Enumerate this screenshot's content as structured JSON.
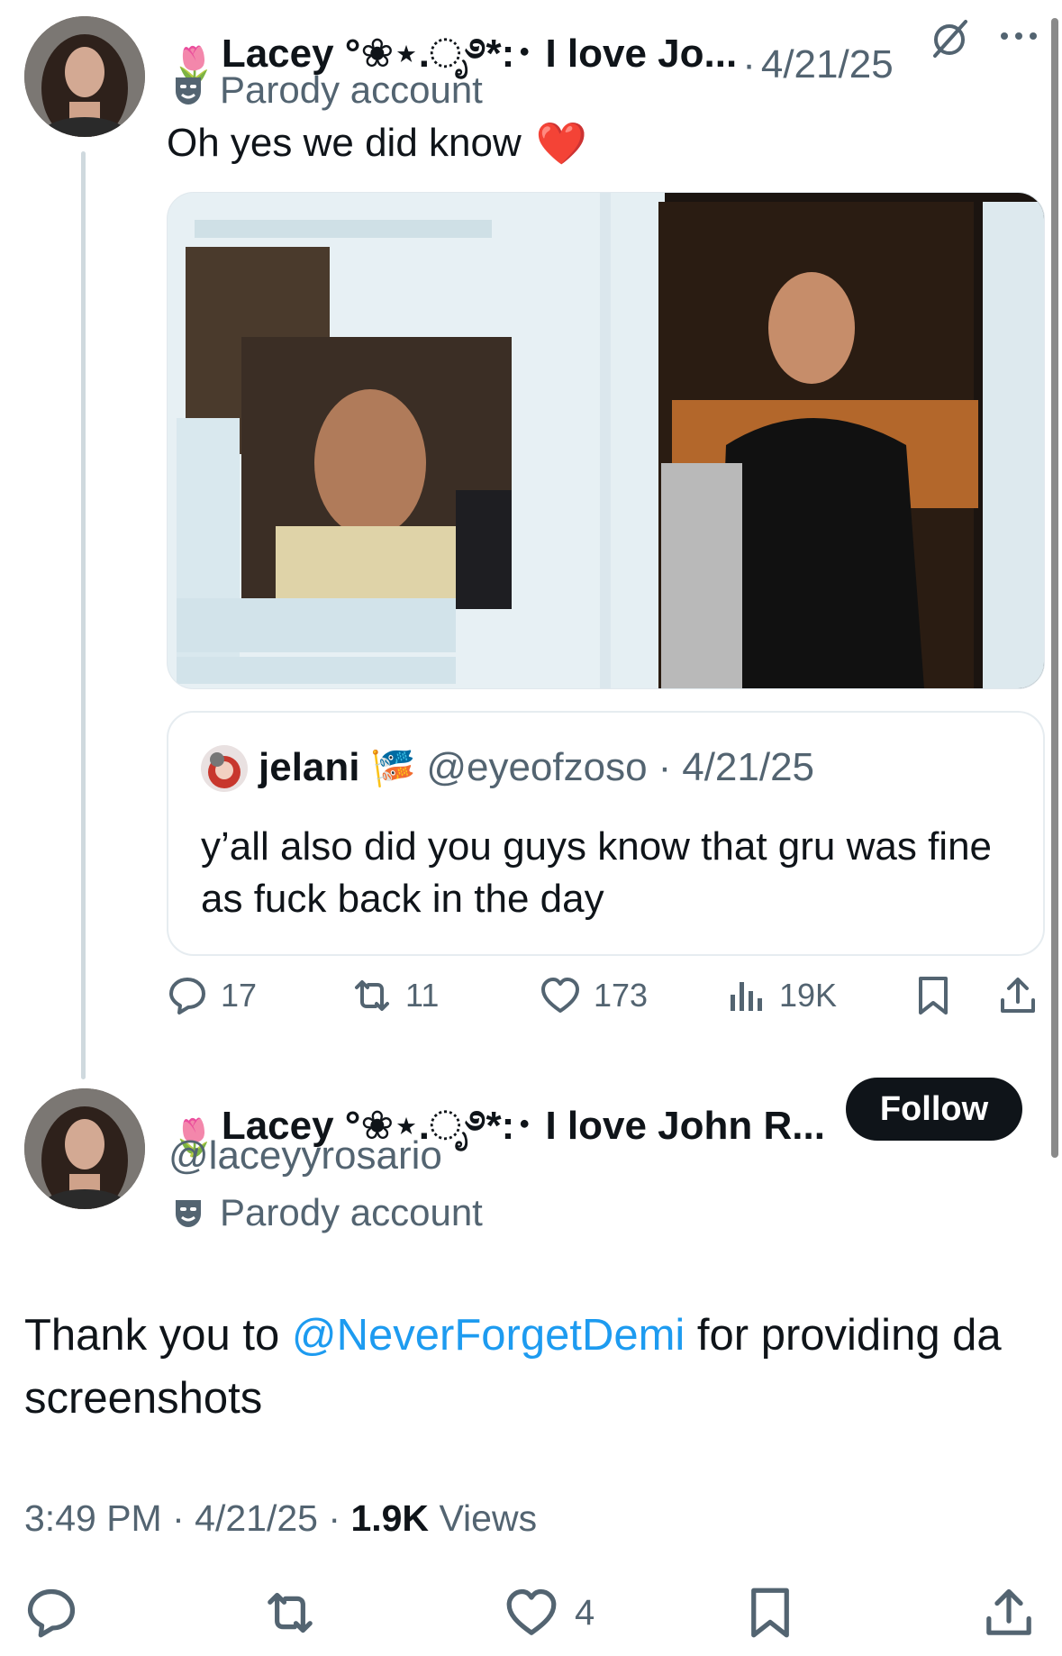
{
  "tweet1": {
    "emoji_prefix": "🌷",
    "display_name": "Lacey °❀⋆.ೃ࿔*:･ I love Jo...",
    "date_sep": "·",
    "date": "4/21/25",
    "parody_label": "Parody account",
    "text": "Oh yes we did know",
    "heart_emoji": "❤️",
    "quote": {
      "name": "jelani",
      "name_emoji": "🎏",
      "handle": "@eyeofzoso",
      "date": "4/21/25",
      "text": "y’all also did you guys know that gru was fine as fuck back in the day"
    },
    "actions": {
      "replies": "17",
      "reposts": "11",
      "likes": "173",
      "views": "19K"
    }
  },
  "tweet2": {
    "emoji_prefix": "🌷",
    "display_name": "Lacey °❀⋆.ೃ࿔*:･ I love John R...",
    "handle": "@laceyyrosario",
    "parody_label": "Parody account",
    "follow_label": "Follow",
    "text_before": "Thank you to ",
    "mention": "@NeverForgetDemi",
    "text_after": " for providing da screenshots",
    "time": "3:49 PM",
    "date": "4/21/25",
    "views_count": "1.9K",
    "views_label": "Views",
    "likes": "4"
  },
  "colors": {
    "link": "#1d9bf0",
    "text": "#0f1419",
    "muted": "#536471",
    "like_red": "#f4212e"
  },
  "icons": [
    "more-icon",
    "parody-mask-icon",
    "reply-icon",
    "repost-icon",
    "like-icon",
    "views-icon",
    "bookmark-icon",
    "share-icon"
  ]
}
